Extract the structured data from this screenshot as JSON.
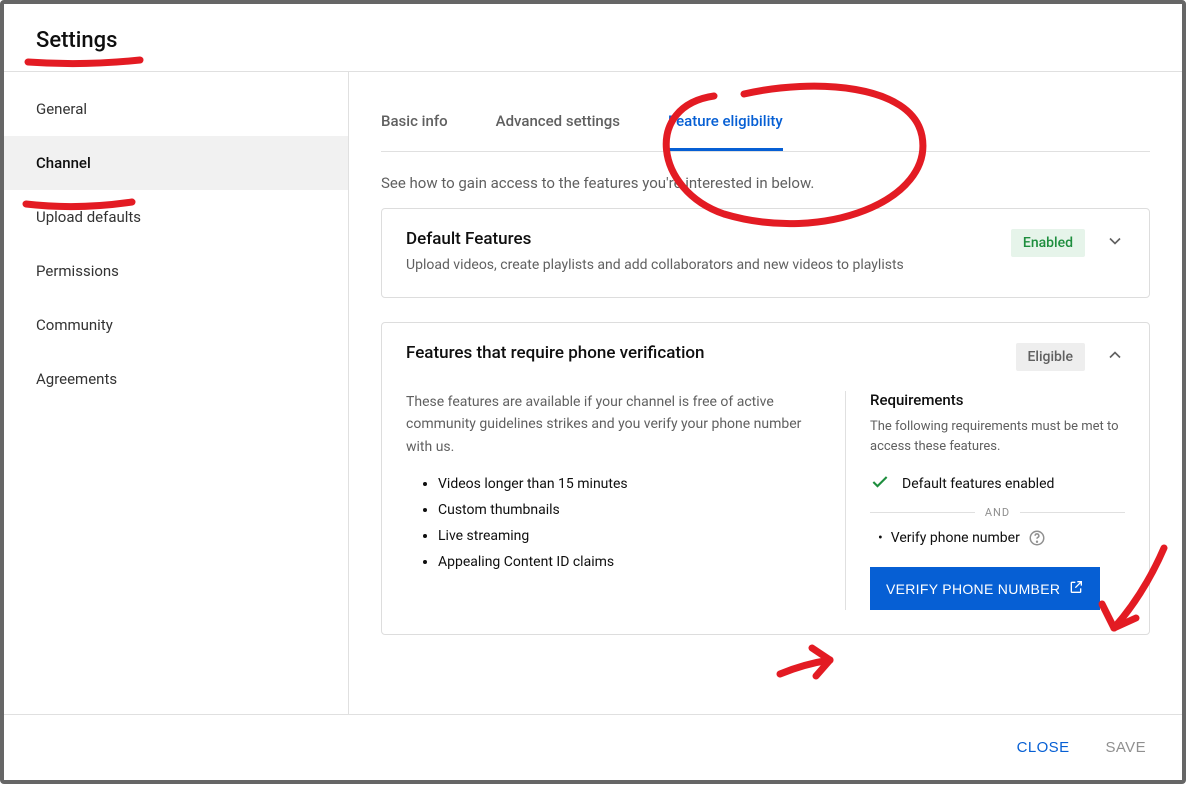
{
  "header": {
    "title": "Settings"
  },
  "sidebar": {
    "items": [
      {
        "label": "General"
      },
      {
        "label": "Channel"
      },
      {
        "label": "Upload defaults"
      },
      {
        "label": "Permissions"
      },
      {
        "label": "Community"
      },
      {
        "label": "Agreements"
      }
    ],
    "activeIndex": 1
  },
  "tabs": {
    "items": [
      {
        "label": "Basic info"
      },
      {
        "label": "Advanced settings"
      },
      {
        "label": "Feature eligibility"
      }
    ],
    "activeIndex": 2
  },
  "intro": "See how to gain access to the features you're interested in below.",
  "defaultCard": {
    "title": "Default Features",
    "subtitle": "Upload videos, create playlists and add collaborators and new videos to playlists",
    "badge": "Enabled"
  },
  "phoneCard": {
    "title": "Features that require phone verification",
    "badge": "Eligible",
    "desc": "These features are available if your channel is free of active community guidelines strikes and you verify your phone number with us.",
    "features": [
      "Videos longer than 15 minutes",
      "Custom thumbnails",
      "Live streaming",
      "Appealing Content ID claims"
    ],
    "requirements": {
      "heading": "Requirements",
      "sub": "The following requirements must be met to access these features.",
      "met": "Default features enabled",
      "and": "AND",
      "pending": "Verify phone number",
      "button": "VERIFY PHONE NUMBER"
    }
  },
  "footer": {
    "close": "CLOSE",
    "save": "SAVE"
  }
}
